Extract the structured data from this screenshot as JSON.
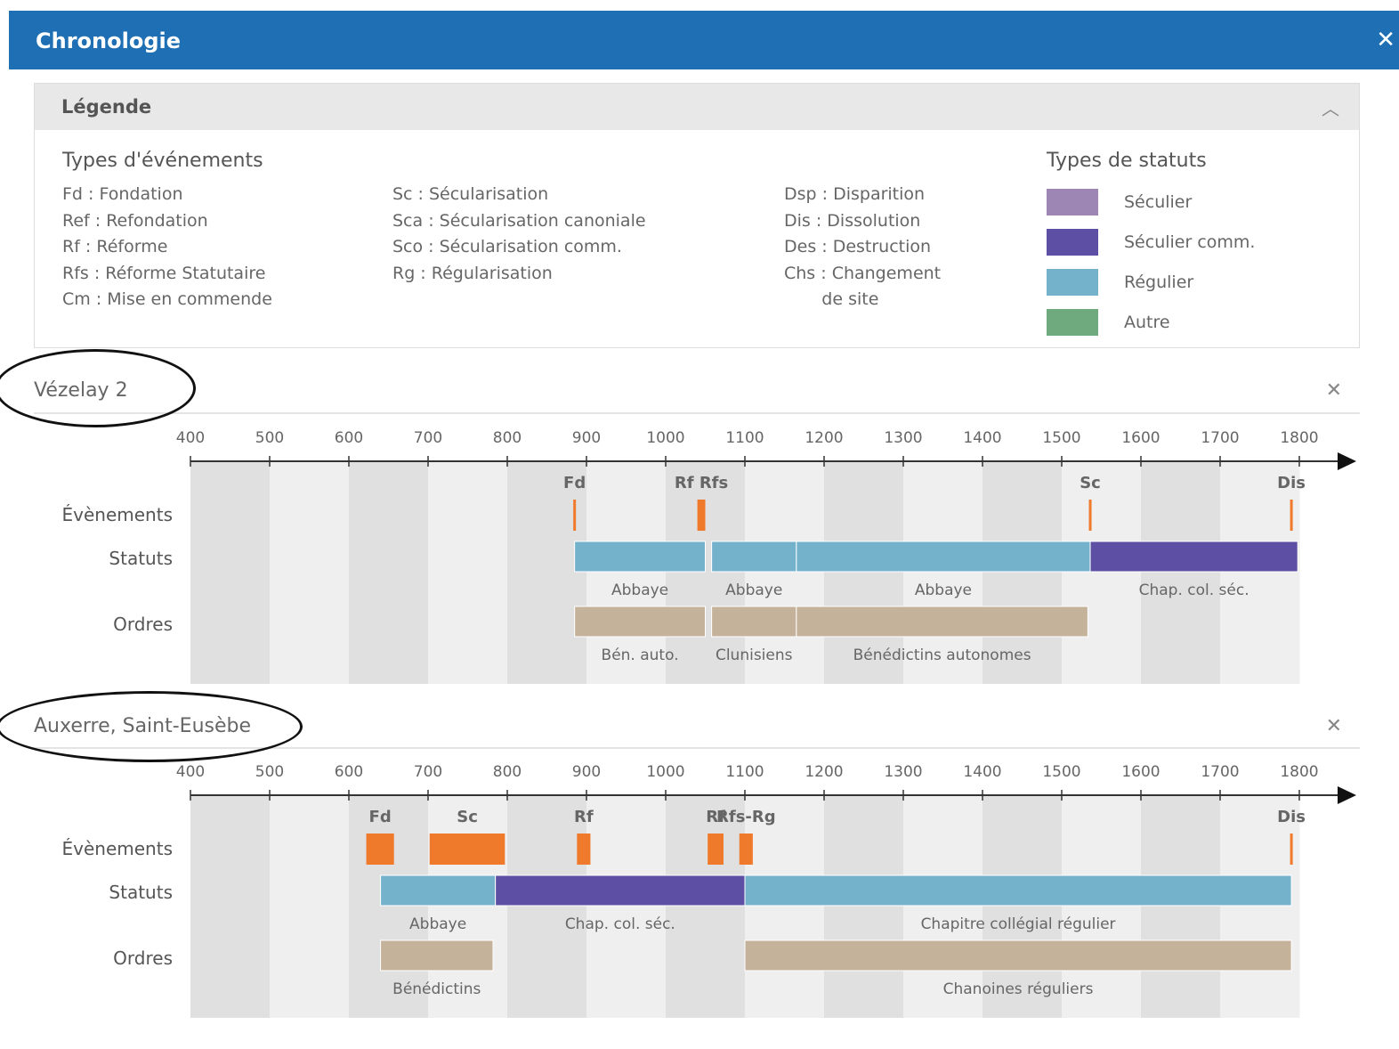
{
  "window": {
    "title": "Chronologie",
    "close_icon": "close-icon"
  },
  "legend": {
    "title": "Légende",
    "event_types_title": "Types d'événements",
    "events_col1": [
      "Fd : Fondation",
      "Ref : Refondation",
      "Rf : Réforme",
      "Rfs : Réforme Statutaire",
      "Cm : Mise en commende"
    ],
    "events_col2": [
      "Sc : Sécularisation",
      "Sca : Sécularisation canoniale",
      "Sco : Sécularisation comm.",
      "Rg : Régularisation"
    ],
    "events_col3": [
      "Dsp : Disparition",
      "Dis : Dissolution",
      "Des : Destruction",
      "Chs : Changement",
      "       de site"
    ],
    "status_types_title": "Types de statuts",
    "statuses": [
      {
        "label": "Séculier",
        "color": "#9d86b3"
      },
      {
        "label": "Séculier comm.",
        "color": "#5d4fa3"
      },
      {
        "label": "Régulier",
        "color": "#74b2cc"
      },
      {
        "label": "Autre",
        "color": "#6eaa7d"
      }
    ]
  },
  "row_labels": {
    "events": "Évènements",
    "statuses": "Statuts",
    "orders": "Ordres"
  },
  "timelines": [
    {
      "title": "Vézelay 2",
      "axis_ticks": [
        "400",
        "500",
        "600",
        "700",
        "800",
        "900",
        "1000",
        "1100",
        "1200",
        "1300",
        "1400",
        "1500",
        "1600",
        "1700",
        "1800"
      ],
      "events": [
        {
          "code": "Fd",
          "start": 885,
          "end": 885
        },
        {
          "code": "Rf Rfs",
          "start": 1040,
          "end": 1050
        },
        {
          "code": "Sc",
          "start": 1536,
          "end": 1536
        },
        {
          "code": "Dis",
          "start": 1790,
          "end": 1790
        }
      ],
      "statuses": [
        {
          "label": "Abbaye",
          "start": 885,
          "end": 1050,
          "color": "#74b2cc"
        },
        {
          "label": "Abbaye",
          "start": 1058,
          "end": 1165,
          "color": "#74b2cc"
        },
        {
          "label": "Abbaye",
          "start": 1165,
          "end": 1536,
          "color": "#74b2cc"
        },
        {
          "label": "Chap. col. séc.",
          "start": 1536,
          "end": 1798,
          "color": "#5d4fa3"
        }
      ],
      "orders": [
        {
          "label": "Bén. auto.",
          "start": 885,
          "end": 1050
        },
        {
          "label": "Clunisiens",
          "start": 1058,
          "end": 1165
        },
        {
          "label": "Bénédictins autonomes",
          "start": 1165,
          "end": 1533
        }
      ]
    },
    {
      "title": "Auxerre, Saint-Eusèbe",
      "axis_ticks": [
        "400",
        "500",
        "600",
        "700",
        "800",
        "900",
        "1000",
        "1100",
        "1200",
        "1300",
        "1400",
        "1500",
        "1600",
        "1700",
        "1800"
      ],
      "events": [
        {
          "code": "Fd",
          "start": 622,
          "end": 657
        },
        {
          "code": "Sc",
          "start": 702,
          "end": 797
        },
        {
          "code": "Rf",
          "start": 888,
          "end": 905
        },
        {
          "code": "Rf",
          "start": 1053,
          "end": 1073
        },
        {
          "code": "Rfs-Rg",
          "start": 1093,
          "end": 1110
        },
        {
          "code": "Dis",
          "start": 1790,
          "end": 1790
        }
      ],
      "statuses": [
        {
          "label": "Abbaye",
          "start": 640,
          "end": 785,
          "color": "#74b2cc"
        },
        {
          "label": "Chap. col. séc.",
          "start": 785,
          "end": 1100,
          "color": "#5d4fa3"
        },
        {
          "label": "Chapitre collégial régulier",
          "start": 1100,
          "end": 1790,
          "color": "#74b2cc"
        }
      ],
      "orders": [
        {
          "label": "Bénédictins",
          "start": 640,
          "end": 782
        },
        {
          "label": "Chanoines réguliers",
          "start": 1100,
          "end": 1790
        }
      ]
    }
  ]
}
